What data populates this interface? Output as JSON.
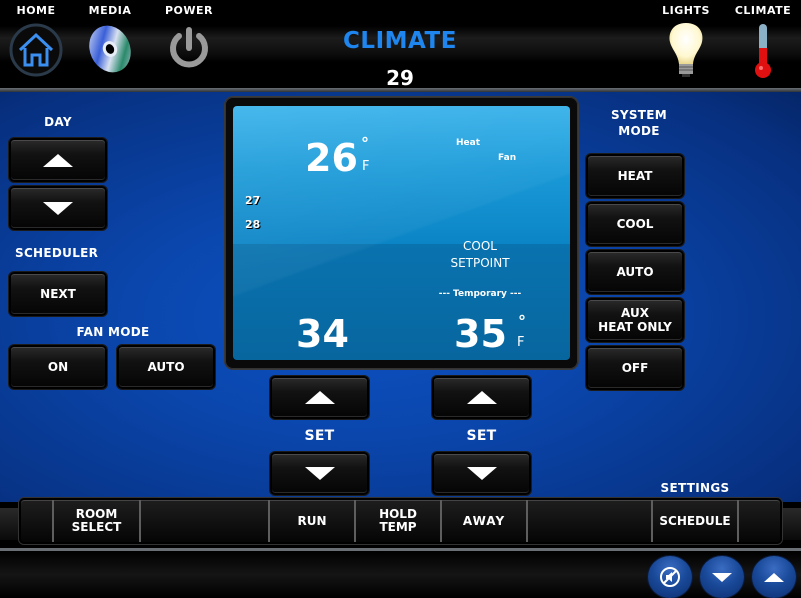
{
  "header": {
    "nav_left": [
      {
        "label": "HOME",
        "icon": "home-icon"
      },
      {
        "label": "MEDIA",
        "icon": "disc-icon"
      },
      {
        "label": "POWER",
        "icon": "power-icon"
      }
    ],
    "nav_right": [
      {
        "label": "LIGHTS",
        "icon": "lightbulb-icon"
      },
      {
        "label": "CLIMATE",
        "icon": "thermometer-icon"
      }
    ],
    "title": "CLIMATE",
    "outdoor_temp": "29"
  },
  "left_panel": {
    "day_label": "DAY",
    "scheduler_label": "SCHEDULER",
    "next_button": "NEXT",
    "fan_mode_label": "FAN MODE",
    "fan_on_button": "ON",
    "fan_auto_button": "AUTO"
  },
  "display": {
    "current_temp": "26",
    "degree_symbol": "°",
    "unit": "F",
    "mode_status": "Heat",
    "fan_status": "Fan",
    "list_values": [
      "27",
      "28"
    ],
    "setpoint_type_line1": "COOL",
    "setpoint_type_line2": "SETPOINT",
    "hold_status": "--- Temporary ---",
    "left_setpoint": "34",
    "right_setpoint": "35"
  },
  "setpoint_controls": {
    "set_label_left": "SET",
    "set_label_right": "SET"
  },
  "system_mode": {
    "label_line1": "SYSTEM",
    "label_line2": "MODE",
    "buttons": [
      {
        "label": "HEAT"
      },
      {
        "label": "COOL"
      },
      {
        "label": "AUTO"
      },
      {
        "label_line1": "AUX",
        "label_line2": "HEAT ONLY"
      },
      {
        "label": "OFF"
      }
    ]
  },
  "bottom_bar": {
    "settings_label": "SETTINGS",
    "cells": [
      {
        "label": ""
      },
      {
        "label_line1": "ROOM",
        "label_line2": "SELECT"
      },
      {
        "label": ""
      },
      {
        "label": "RUN"
      },
      {
        "label_line1": "HOLD",
        "label_line2": "TEMP"
      },
      {
        "label": "AWAY"
      },
      {
        "label": ""
      },
      {
        "label": "SCHEDULE"
      },
      {
        "label": ""
      }
    ]
  },
  "footer": {
    "buttons": [
      "mute",
      "volume-down",
      "volume-up"
    ]
  },
  "colors": {
    "title_blue": "#1e86ee",
    "panel_blue": "#0a45aa",
    "lcd_blue": "#1a9ad8",
    "thermometer_red": "#e01010"
  }
}
